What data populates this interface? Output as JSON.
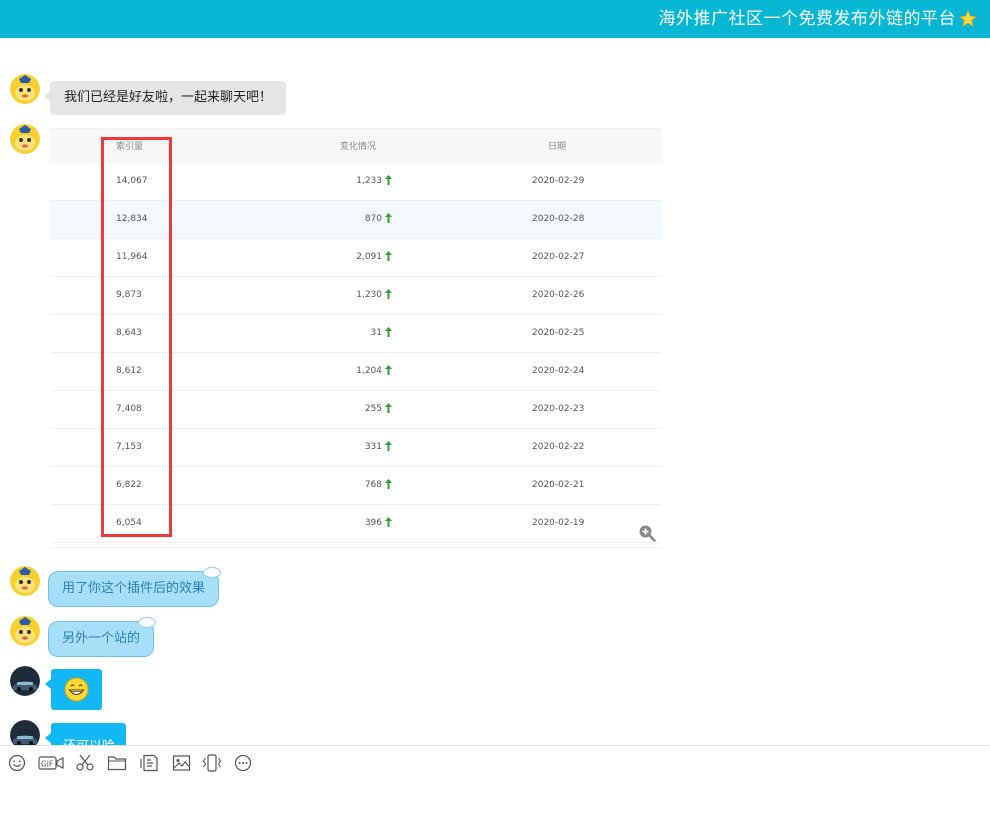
{
  "header": {
    "title": "海外推广社区一个免费发布外链的平台"
  },
  "messages": {
    "m1": "我们已经是好友啦，一起来聊天吧！",
    "m3": "用了你这个插件后的效果",
    "m4": "另外一个站的",
    "m6": "还可以哈"
  },
  "table": {
    "headers": [
      "索引量",
      "变化情况",
      "日期"
    ],
    "rows": [
      [
        "14,067",
        "1,233",
        "2020-02-29"
      ],
      [
        "12,834",
        "870",
        "2020-02-28"
      ],
      [
        "11,964",
        "2,091",
        "2020-02-27"
      ],
      [
        "9,873",
        "1,230",
        "2020-02-26"
      ],
      [
        "8,643",
        "31",
        "2020-02-25"
      ],
      [
        "8,612",
        "1,204",
        "2020-02-24"
      ],
      [
        "7,408",
        "255",
        "2020-02-23"
      ],
      [
        "7,153",
        "331",
        "2020-02-22"
      ],
      [
        "6,822",
        "768",
        "2020-02-21"
      ],
      [
        "6,054",
        "396",
        "2020-02-19"
      ]
    ]
  },
  "toolbar": {
    "tools": [
      "smile-icon",
      "gif-icon",
      "scissors-icon",
      "folder-icon",
      "image-shake-icon",
      "image-icon",
      "vibrate-icon",
      "more-icon"
    ]
  },
  "colors": {
    "header": "#06b6d2",
    "highlight": "#ee3a3a",
    "bubble_blue": "#12b7f5",
    "arrow_up": "#3a9b3a"
  }
}
